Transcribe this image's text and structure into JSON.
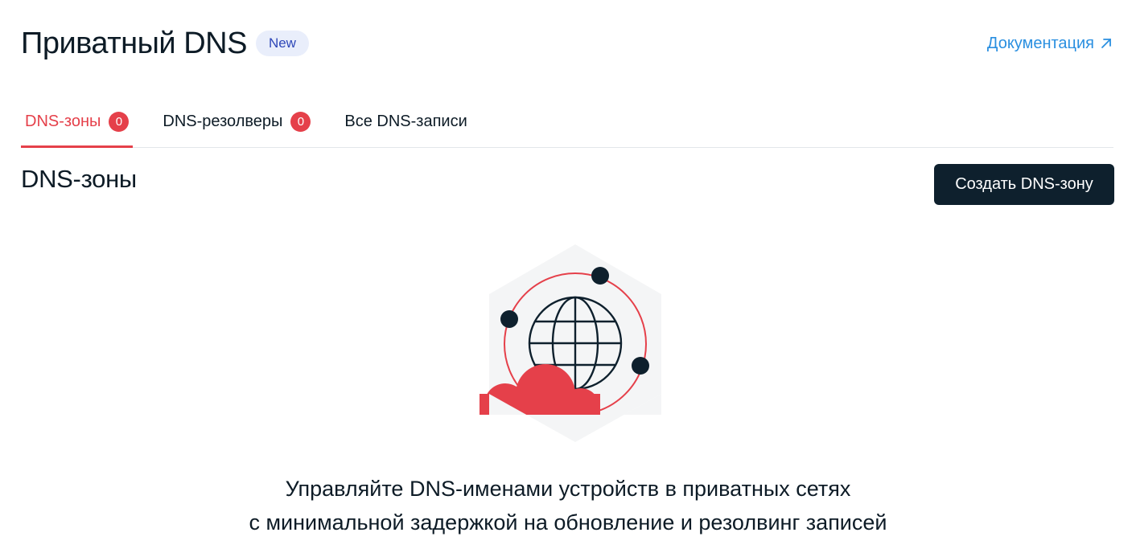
{
  "header": {
    "title": "Приватный DNS",
    "badge": "New",
    "doc_link": "Документация",
    "doc_icon": "external-link-arrow-icon"
  },
  "tabs": [
    {
      "label": "DNS-зоны",
      "count": "0",
      "active": true
    },
    {
      "label": "DNS-резолверы",
      "count": "0",
      "active": false
    },
    {
      "label": "Все DNS-записи",
      "active": false
    }
  ],
  "section": {
    "title": "DNS-зоны",
    "create_button": "Создать DNS-зону"
  },
  "empty_state": {
    "icon": "globe-network-cloud-illustration",
    "line1": "Управляйте DNS-именами устройств в приватных сетях",
    "line2": "с минимальной задержкой на обновление и резолвинг записей"
  },
  "colors": {
    "accent": "#e5404a",
    "link": "#2a8fe0",
    "dark": "#0e202d",
    "badge_bg": "#e9eefb",
    "badge_text": "#2e47b8"
  }
}
